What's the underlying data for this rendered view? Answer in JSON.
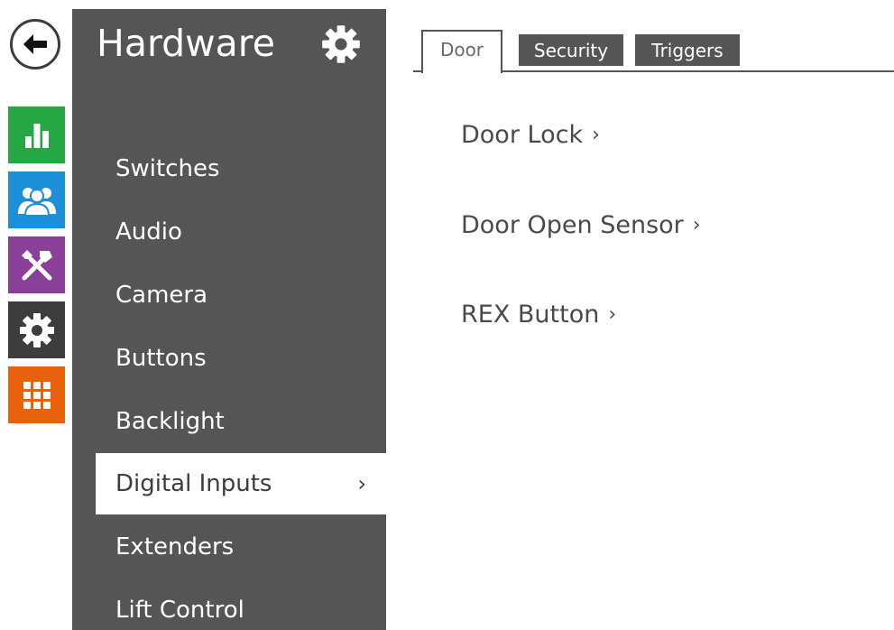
{
  "rail": {
    "back_icon": "arrow-left-icon",
    "tiles": [
      {
        "name": "status",
        "icon": "bar-chart-icon",
        "color": "#27a744"
      },
      {
        "name": "directory",
        "icon": "users-icon",
        "color": "#1d8fd6"
      },
      {
        "name": "hardware",
        "icon": "tools-icon",
        "color": "#8a3f98"
      },
      {
        "name": "system",
        "icon": "gear-icon",
        "color": "#3d3d3d"
      },
      {
        "name": "services",
        "icon": "grid-icon",
        "color": "#e8610c"
      }
    ]
  },
  "sidebar": {
    "title": "Hardware",
    "settings_icon": "gear-icon",
    "background": "#555555",
    "items": [
      {
        "label": "Switches"
      },
      {
        "label": "Audio"
      },
      {
        "label": "Camera"
      },
      {
        "label": "Buttons"
      },
      {
        "label": "Backlight"
      },
      {
        "label": "Digital Inputs",
        "active": true,
        "chevron": "›"
      },
      {
        "label": "Extenders"
      },
      {
        "label": "Lift Control"
      }
    ]
  },
  "tabs": [
    {
      "label": "Door",
      "active": true
    },
    {
      "label": "Security",
      "active": false
    },
    {
      "label": "Triggers",
      "active": false
    }
  ],
  "content": {
    "links": [
      {
        "label": "Door Lock",
        "chevron": "›"
      },
      {
        "label": "Door Open Sensor",
        "chevron": "›"
      },
      {
        "label": "REX Button",
        "chevron": "›"
      }
    ]
  }
}
